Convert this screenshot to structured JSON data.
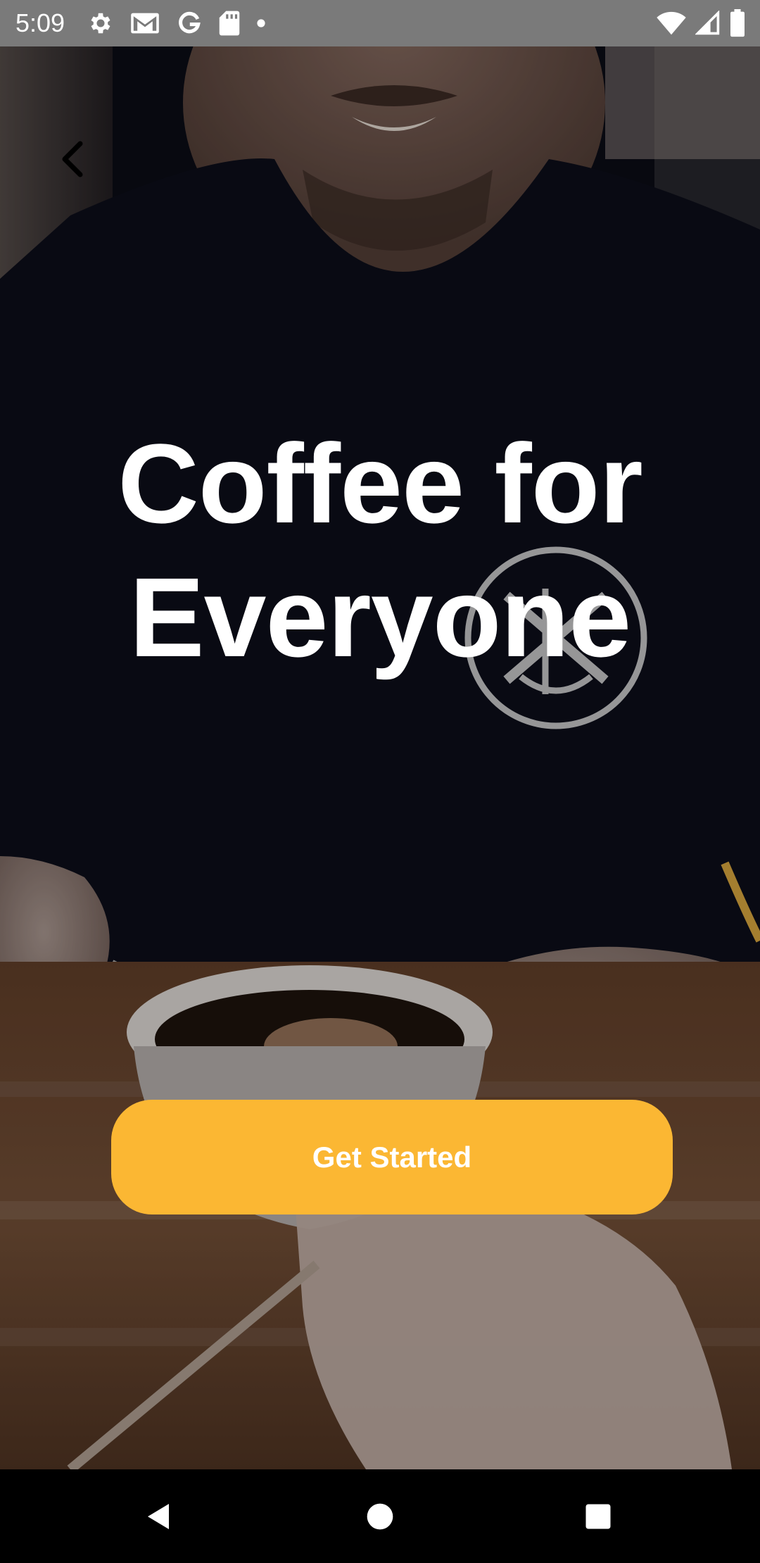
{
  "status_bar": {
    "time": "5:09",
    "left_icons": [
      "gear-icon",
      "gmail-icon",
      "google-icon",
      "sd-card-icon",
      "notification-dot-icon"
    ],
    "right_icons": [
      "wifi-icon",
      "cellular-signal-icon",
      "battery-icon"
    ]
  },
  "hero": {
    "background": "photo of a man at a table stirring a cup of coffee",
    "headline_line1": "Coffee for",
    "headline_line2": "Everyone"
  },
  "cta": {
    "label": "Get Started",
    "color": "#fbb733"
  },
  "nav_bar": {
    "buttons": [
      "back-triangle-icon",
      "home-circle-icon",
      "recents-square-icon"
    ]
  }
}
